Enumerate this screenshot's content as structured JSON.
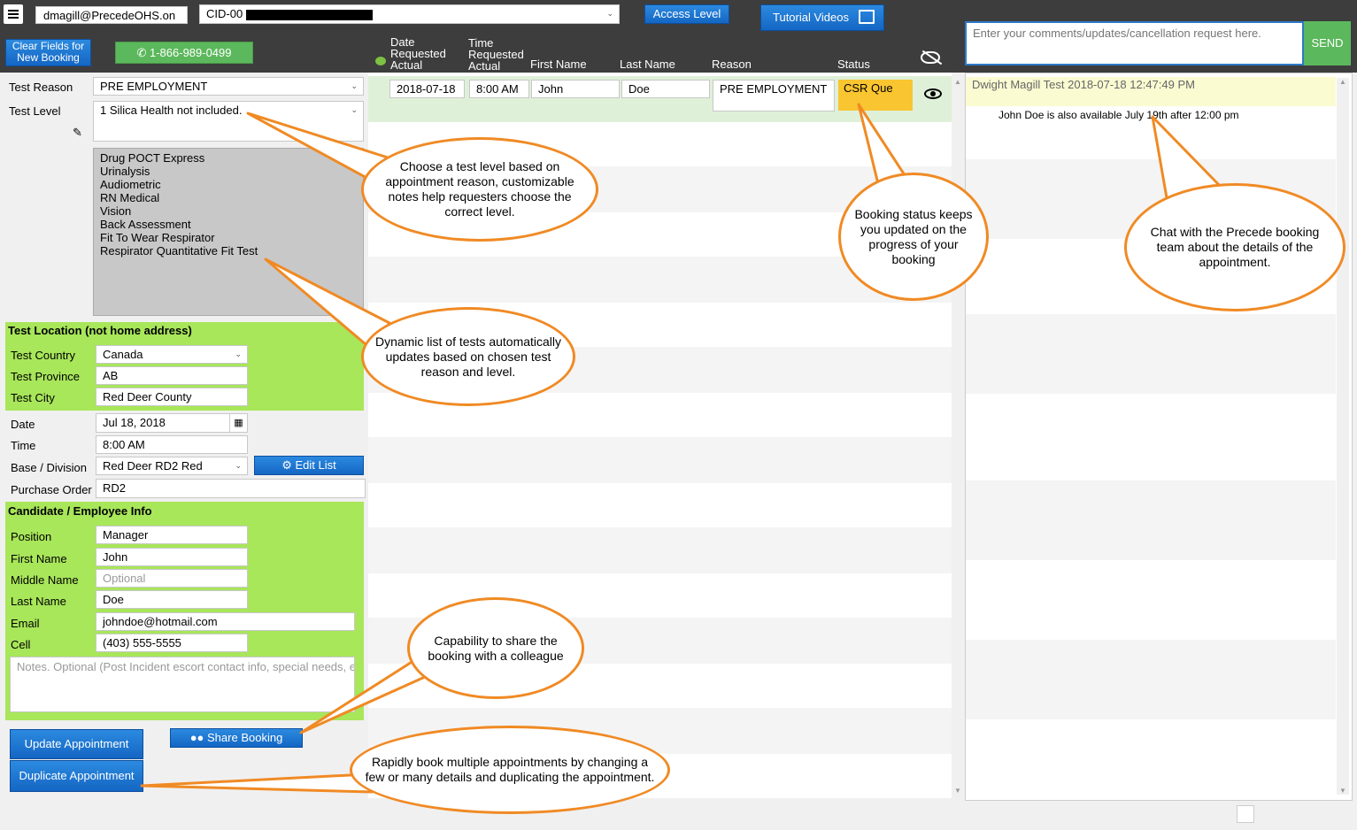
{
  "topbar": {
    "user_email": "dmagill@PrecedeOHS.on",
    "cid_prefix": "CID-00",
    "access_level_label": "Access Level",
    "tutorial_videos_label": "Tutorial Videos",
    "clear_fields_label": "Clear Fields for New Booking",
    "phone_label": "1-866-989-0499",
    "comment_placeholder": "Enter your comments/updates/cancellation request here.",
    "send_label": "SEND"
  },
  "table_headers": {
    "date": "Date Requested Actual",
    "time": "Time Requested Actual",
    "first_name": "First Name",
    "last_name": "Last Name",
    "reason": "Reason",
    "status": "Status"
  },
  "booking_row": {
    "date": "2018-07-18",
    "time": "8:00 AM",
    "first_name": "John",
    "last_name": "Doe",
    "reason": "PRE EMPLOYMENT",
    "status": "CSR Que"
  },
  "form": {
    "test_reason_label": "Test Reason",
    "test_reason_value": "PRE EMPLOYMENT",
    "test_level_label": "Test Level",
    "test_level_value": "1 Silica Health not included.",
    "tests": [
      "Drug POCT Express",
      "Urinalysis",
      "Audiometric",
      "RN Medical",
      "Vision",
      "Back Assessment",
      "Fit To Wear Respirator",
      "Respirator Quantitative Fit Test"
    ],
    "location_title": "Test Location (not home address)",
    "country_label": "Test Country",
    "country_value": "Canada",
    "province_label": "Test Province",
    "province_value": "AB",
    "city_label": "Test City",
    "city_value": "Red Deer County",
    "date_label": "Date",
    "date_value": "Jul 18, 2018",
    "time_label": "Time",
    "time_value": "8:00 AM",
    "base_label": "Base / Division",
    "base_value": "Red Deer RD2 Red",
    "edit_list_label": "Edit List",
    "po_label": "Purchase Order",
    "po_value": "RD2",
    "candidate_title": "Candidate / Employee Info",
    "position_label": "Position",
    "position_value": "Manager",
    "first_label": "First Name",
    "first_value": "John",
    "middle_label": "Middle Name",
    "middle_placeholder": "Optional",
    "last_label": "Last Name",
    "last_value": "Doe",
    "email_label": "Email",
    "email_value": "johndoe@hotmail.com",
    "cell_label": "Cell",
    "cell_value": "(403) 555-5555",
    "notes_placeholder": "Notes. Optional (Post Incident escort contact info, special needs, e",
    "update_label": "Update Appointment",
    "duplicate_label": "Duplicate Appointment",
    "share_label": "Share Booking"
  },
  "chat": {
    "header": "Dwight Magill Test 2018-07-18 12:47:49 PM",
    "message": "John Doe is also available July 19th after 12:00 pm"
  },
  "callouts": {
    "test_level": "Choose a test level based on appointment reason, customizable notes help requesters choose the correct level.",
    "dynamic_list": "Dynamic list of tests automatically updates based on chosen test reason and level.",
    "status": "Booking status keeps you updated on the progress of your booking",
    "chat": "Chat with the Precede booking team about the details of the appointment.",
    "share": "Capability to share the booking with a colleague",
    "duplicate": "Rapidly book multiple appointments by changing a few or many details and duplicating the appointment."
  },
  "colors": {
    "topbar": "#3d3d3d",
    "green_section": "#a8e65a",
    "status_badge": "#f9c531",
    "callout_border": "#f08a24",
    "button_blue": "#1a75d1"
  }
}
